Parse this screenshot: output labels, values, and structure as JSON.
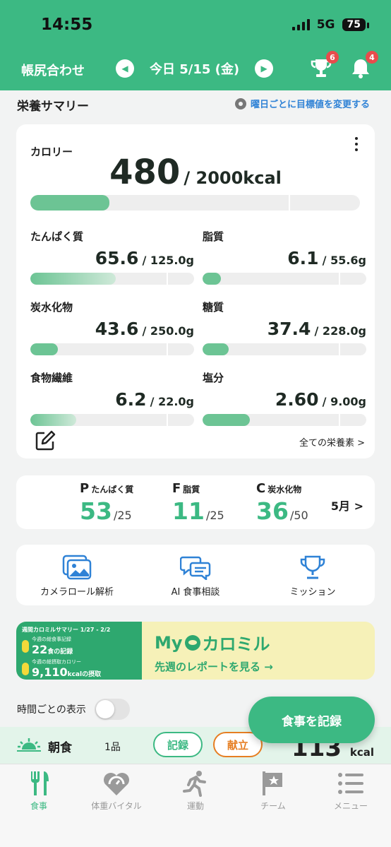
{
  "status_bar": {
    "time": "14:55",
    "network": "5G",
    "battery": "75"
  },
  "header": {
    "title": "帳尻合わせ",
    "date": "今日 5/15 (金)",
    "trophy_badge": "6",
    "bell_badge": "4"
  },
  "summary": {
    "title": "栄養サマリー",
    "change_goal_link": "曜日ごとに目標値を変更する"
  },
  "calorie": {
    "label": "カロリー",
    "value": "480",
    "total": "/ 2000kcal",
    "progress": 0.24
  },
  "nutrients": [
    {
      "name": "たんぱく質",
      "value": "65.6",
      "total": "/ 125.0g",
      "progress": 0.52
    },
    {
      "name": "脂質",
      "value": "6.1",
      "total": "/ 55.6g",
      "progress": 0.11
    },
    {
      "name": "炭水化物",
      "value": "43.6",
      "total": "/ 250.0g",
      "progress": 0.17
    },
    {
      "name": "糖質",
      "value": "37.4",
      "total": "/ 228.0g",
      "progress": 0.16
    },
    {
      "name": "食物繊維",
      "value": "6.2",
      "total": "/ 22.0g",
      "progress": 0.28
    },
    {
      "name": "塩分",
      "value": "2.60",
      "total": "/ 9.00g",
      "progress": 0.29
    }
  ],
  "all_nutrients_link": "全ての栄養素 >",
  "pfc": {
    "protein": {
      "letter": "P",
      "label": "たんぱく質",
      "value": "53",
      "denom": "/25"
    },
    "fat": {
      "letter": "F",
      "label": "脂質",
      "value": "11",
      "denom": "/25"
    },
    "carb": {
      "letter": "C",
      "label": "炭水化物",
      "value": "36",
      "denom": "/50"
    },
    "month": "5月 >"
  },
  "features": [
    {
      "label": "カメラロール解析",
      "icon": "image-gallery-icon"
    },
    {
      "label": "AI 食事相談",
      "icon": "chat-bubbles-icon"
    },
    {
      "label": "ミッション",
      "icon": "trophy-icon"
    }
  ],
  "banner": {
    "left_title": "週間カロミルサマリー 1/27 - 2/2",
    "record_label": "今週の総食事記録",
    "record_value": "22",
    "record_unit": "食の記録",
    "kcal_label": "今週の総摂取カロリー",
    "kcal_value": "9,110",
    "kcal_unit": "kcalの摂取",
    "brand_prefix": "My",
    "brand_name": "カロミル",
    "sub": "先週のレポートを見る →"
  },
  "toggle": {
    "label": "時間ごとの表示"
  },
  "meal": {
    "name": "朝食",
    "count": "1品",
    "record_btn": "記録",
    "menu_btn": "献立",
    "kcal_value": "113",
    "kcal_unit": "kcal"
  },
  "fab_label": "食事を記録",
  "tabs": [
    {
      "label": "食事",
      "icon": "fork-knife-icon"
    },
    {
      "label": "体重バイタル",
      "icon": "heart-scale-icon"
    },
    {
      "label": "運動",
      "icon": "running-icon"
    },
    {
      "label": "チーム",
      "icon": "flag-star-icon"
    },
    {
      "label": "メニュー",
      "icon": "list-icon"
    }
  ],
  "colors": {
    "primary": "#3cb983",
    "link": "#2f82d6",
    "badge": "#e84c4c",
    "bar_fill": "#6cc494"
  }
}
